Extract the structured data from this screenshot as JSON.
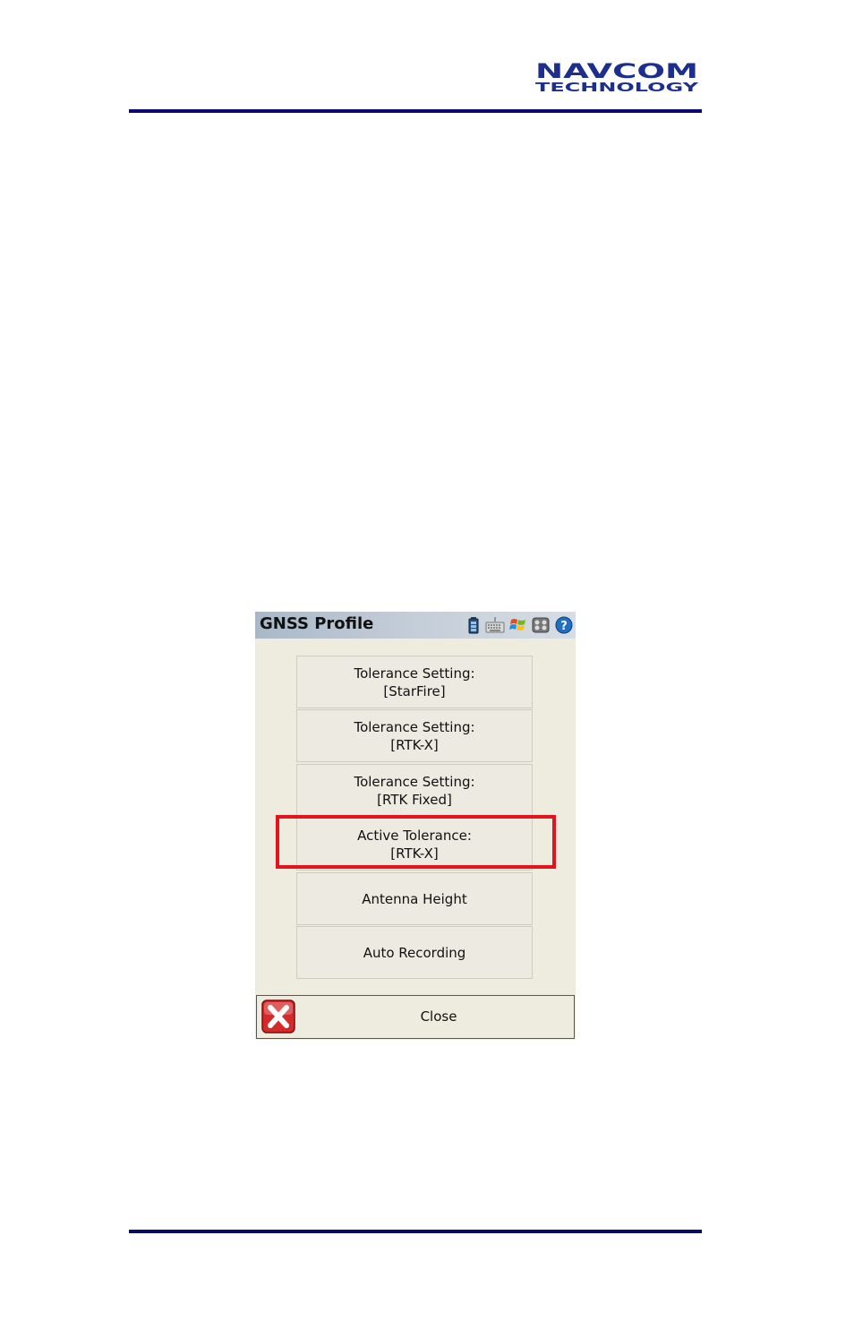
{
  "header": {
    "logo_text_top": "NAVCOM",
    "logo_text_bottom": "TECHNOLOGY"
  },
  "window": {
    "title": "GNSS Profile",
    "tray_icons": [
      "battery-icon",
      "keyboard-icon",
      "windows-flag-icon",
      "settings-icon",
      "help-icon"
    ]
  },
  "menu": [
    {
      "line1": "Tolerance Setting:",
      "line2": "[StarFire]"
    },
    {
      "line1": "Tolerance Setting:",
      "line2": "[RTK-X]"
    },
    {
      "line1": "Tolerance Setting:",
      "line2": "[RTK Fixed]"
    },
    {
      "line1": "Active Tolerance:",
      "line2": "[RTK-X]"
    },
    {
      "line1": "Antenna Height",
      "line2": ""
    },
    {
      "line1": "Auto Recording",
      "line2": ""
    }
  ],
  "footer": {
    "close_label": "Close"
  },
  "colors": {
    "rule": "#0a0a6e",
    "logo": "#1c2f8c",
    "highlight": "#e3141d"
  }
}
